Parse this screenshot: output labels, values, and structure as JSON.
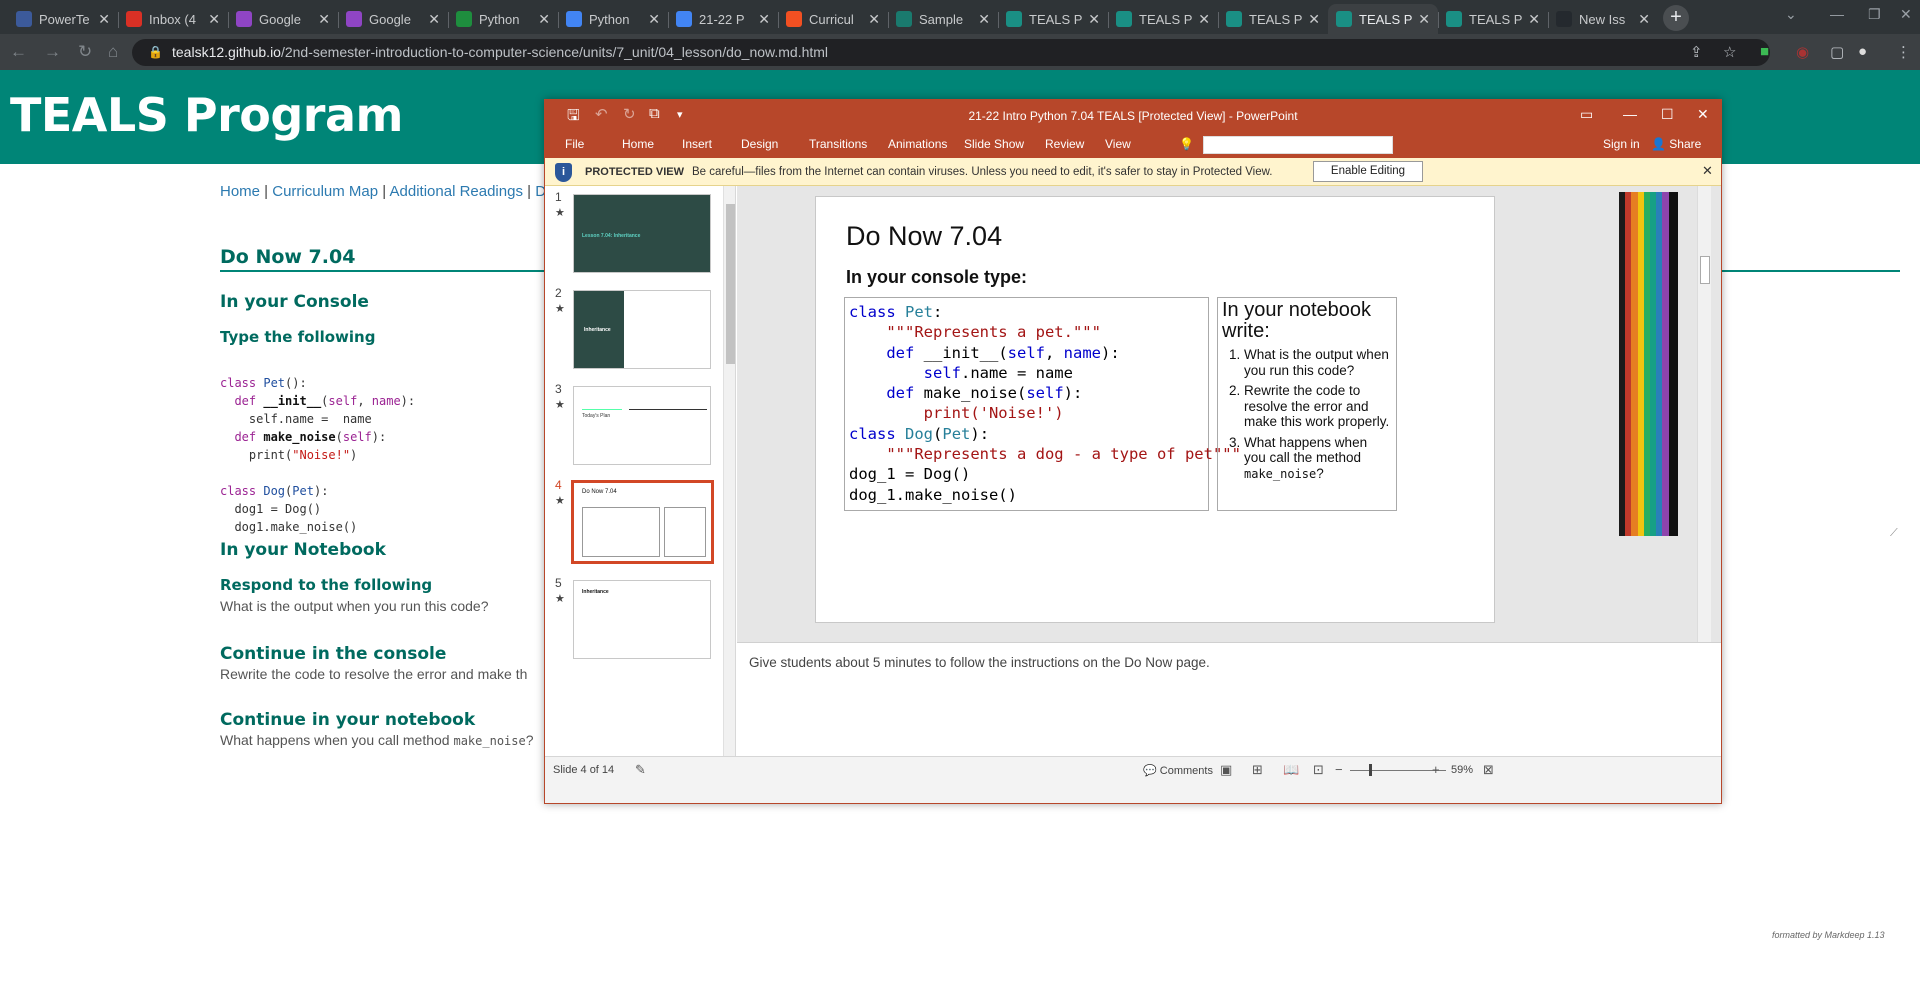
{
  "browser": {
    "tabs": [
      {
        "label": "PowerTe",
        "icon": "sis-icon",
        "color": "#3c5a9a"
      },
      {
        "label": "Inbox (4",
        "icon": "gmail-icon",
        "color": "#d93025"
      },
      {
        "label": "Google",
        "icon": "google-icon",
        "color": "#8f45c4"
      },
      {
        "label": "Google",
        "icon": "google-icon",
        "color": "#8f45c4"
      },
      {
        "label": "Python",
        "icon": "drive-icon",
        "color": "#1e8e3e"
      },
      {
        "label": "Python",
        "icon": "docs-icon",
        "color": "#4285f4"
      },
      {
        "label": "21-22 P",
        "icon": "docs-icon",
        "color": "#4285f4"
      },
      {
        "label": "Curricul",
        "icon": "microsoft-icon",
        "color": "#f25022"
      },
      {
        "label": "Sample",
        "icon": "sample-icon",
        "color": "#1a7a6e"
      },
      {
        "label": "TEALS P",
        "icon": "teals-icon",
        "color": "#1a8f84"
      },
      {
        "label": "TEALS P",
        "icon": "teals-icon",
        "color": "#1a8f84"
      },
      {
        "label": "TEALS P",
        "icon": "teals-icon",
        "color": "#1a8f84"
      },
      {
        "label": "TEALS P",
        "icon": "teals-icon",
        "color": "#1a8f84"
      },
      {
        "label": "TEALS P",
        "icon": "teals-icon",
        "color": "#1a8f84"
      },
      {
        "label": "New Iss",
        "icon": "github-icon",
        "color": "#24292e"
      }
    ],
    "active_tab_index": 12,
    "url_host": "tealsk12.github.io",
    "url_path": "/2nd-semester-introduction-to-computer-science/units/7_unit/04_lesson/do_now.md.html"
  },
  "site": {
    "title": "TEALS Program",
    "nav": {
      "home": "Home",
      "curriculum": "Curriculum Map",
      "readings": "Additional Readings",
      "sep": " | ",
      "trunc": "D"
    },
    "h1": "Do Now 7.04",
    "console_h2": "In your Console",
    "type_h3": "Type the following",
    "notebook_h2": "In your Notebook",
    "respond_h3": "Respond to the following",
    "respond_p": "What is the output when you run this code?",
    "continue_console_h2": "Continue in the console",
    "continue_console_p": "Rewrite the code to resolve the error and make th",
    "continue_notebook_h2": "Continue in your notebook",
    "continue_notebook_p": "What happens when you call method ",
    "continue_notebook_code": "make_noise",
    "continue_notebook_end": "?",
    "markdeep": "formatted by Markdeep 1.13"
  },
  "ppt": {
    "title": "21-22 Intro Python 7.04 TEALS [Protected View] - PowerPoint",
    "ribbon_tabs": [
      "File",
      "Home",
      "Insert",
      "Design",
      "Transitions",
      "Animations",
      "Slide Show",
      "Review",
      "View"
    ],
    "sign_in": "Sign in",
    "share": "Share",
    "protected_label": "PROTECTED VIEW",
    "protected_msg": "Be careful—files from the Internet can contain viruses. Unless you need to edit, it's safer to stay in Protected View.",
    "enable_editing": "Enable Editing",
    "slide_status": "Slide 4 of 14",
    "comments": "Comments",
    "zoom": "59%",
    "notes": "Give students about 5 minutes to follow the instructions on the Do Now page.",
    "thumbnails": [
      {
        "num": "1",
        "title": "Lesson 7.04: Inheritance"
      },
      {
        "num": "2",
        "title": "Inheritance"
      },
      {
        "num": "3",
        "title": "Today's Plan"
      },
      {
        "num": "4",
        "title": "Do Now 7.04"
      },
      {
        "num": "5",
        "title": "Inheritance"
      }
    ],
    "slide": {
      "title": "Do Now 7.04",
      "subtitle": "In your console type:",
      "note_title": "In your notebook write:",
      "note_items": [
        "What is the output when you run this code?",
        "Rewrite the code to resolve the error and make this work properly.",
        "What happens when you call the method "
      ],
      "note_item3_code": "make_noise",
      "note_item3_end": "?"
    },
    "strip_colors": [
      "#1a1a1a",
      "#c0392b",
      "#e67e22",
      "#f1c40f",
      "#27ae60",
      "#16a085",
      "#2980b9",
      "#8e44ad",
      "#111111"
    ]
  }
}
